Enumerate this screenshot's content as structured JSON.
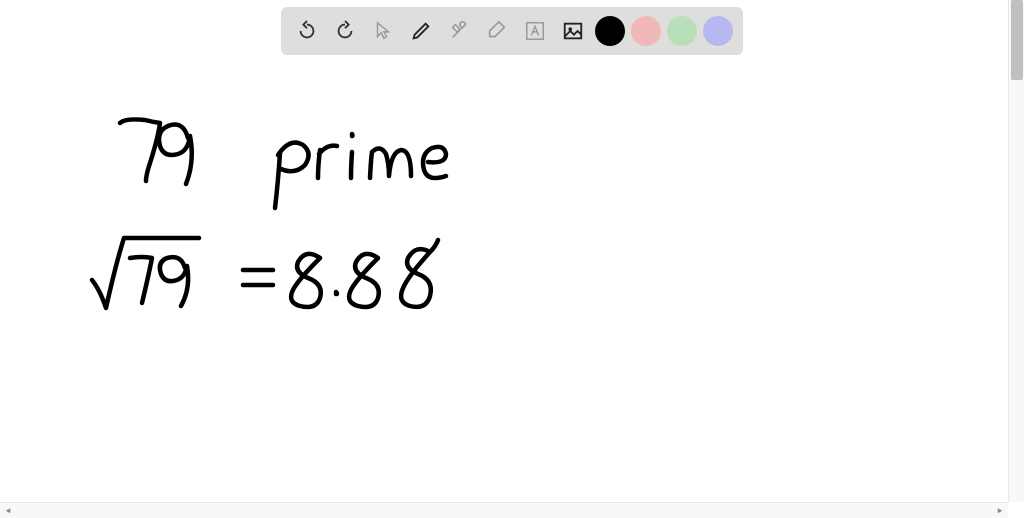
{
  "toolbar": {
    "undo_label": "Undo",
    "redo_label": "Redo",
    "pointer_label": "Pointer",
    "pencil_label": "Pencil",
    "tools_label": "Tools",
    "eraser_label": "Eraser",
    "text_label": "Text",
    "image_label": "Image",
    "colors": {
      "black": "#000000",
      "pink": "#f0b8b8",
      "green": "#b8e0b8",
      "blue": "#b8b8f0"
    }
  },
  "canvas": {
    "line1": {
      "number": "79",
      "word": "prime"
    },
    "line2": {
      "expression": "√79",
      "equals": "=",
      "result": "8.88"
    }
  }
}
